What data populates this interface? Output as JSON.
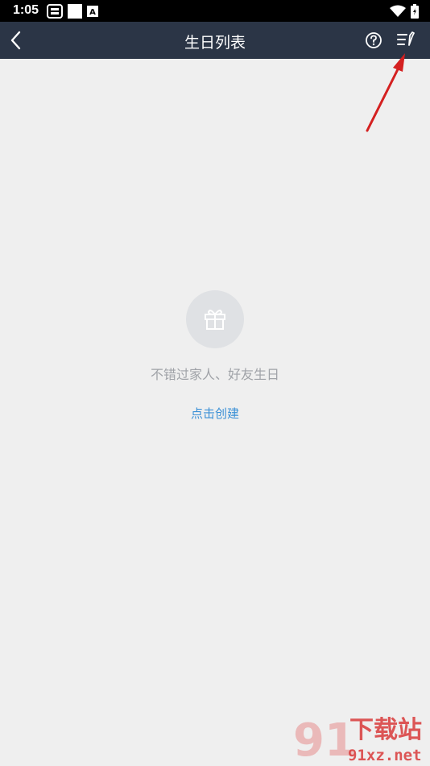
{
  "status_bar": {
    "time": "1:05",
    "notice_icon_text": "A"
  },
  "app_bar": {
    "title": "生日列表",
    "icons": [
      "back-arrow",
      "help-circle",
      "edit-list"
    ]
  },
  "empty_state": {
    "icon": "gift-icon",
    "message": "不错过家人、好友生日",
    "action_label": "点击创建"
  },
  "watermark": {
    "logo_text": "91",
    "brand": "下载站",
    "domain": "91xz.net"
  },
  "colors": {
    "app_bar": "#2b3546",
    "background": "#efefef",
    "link": "#3a90d6",
    "annotation_arrow": "#d42020"
  }
}
